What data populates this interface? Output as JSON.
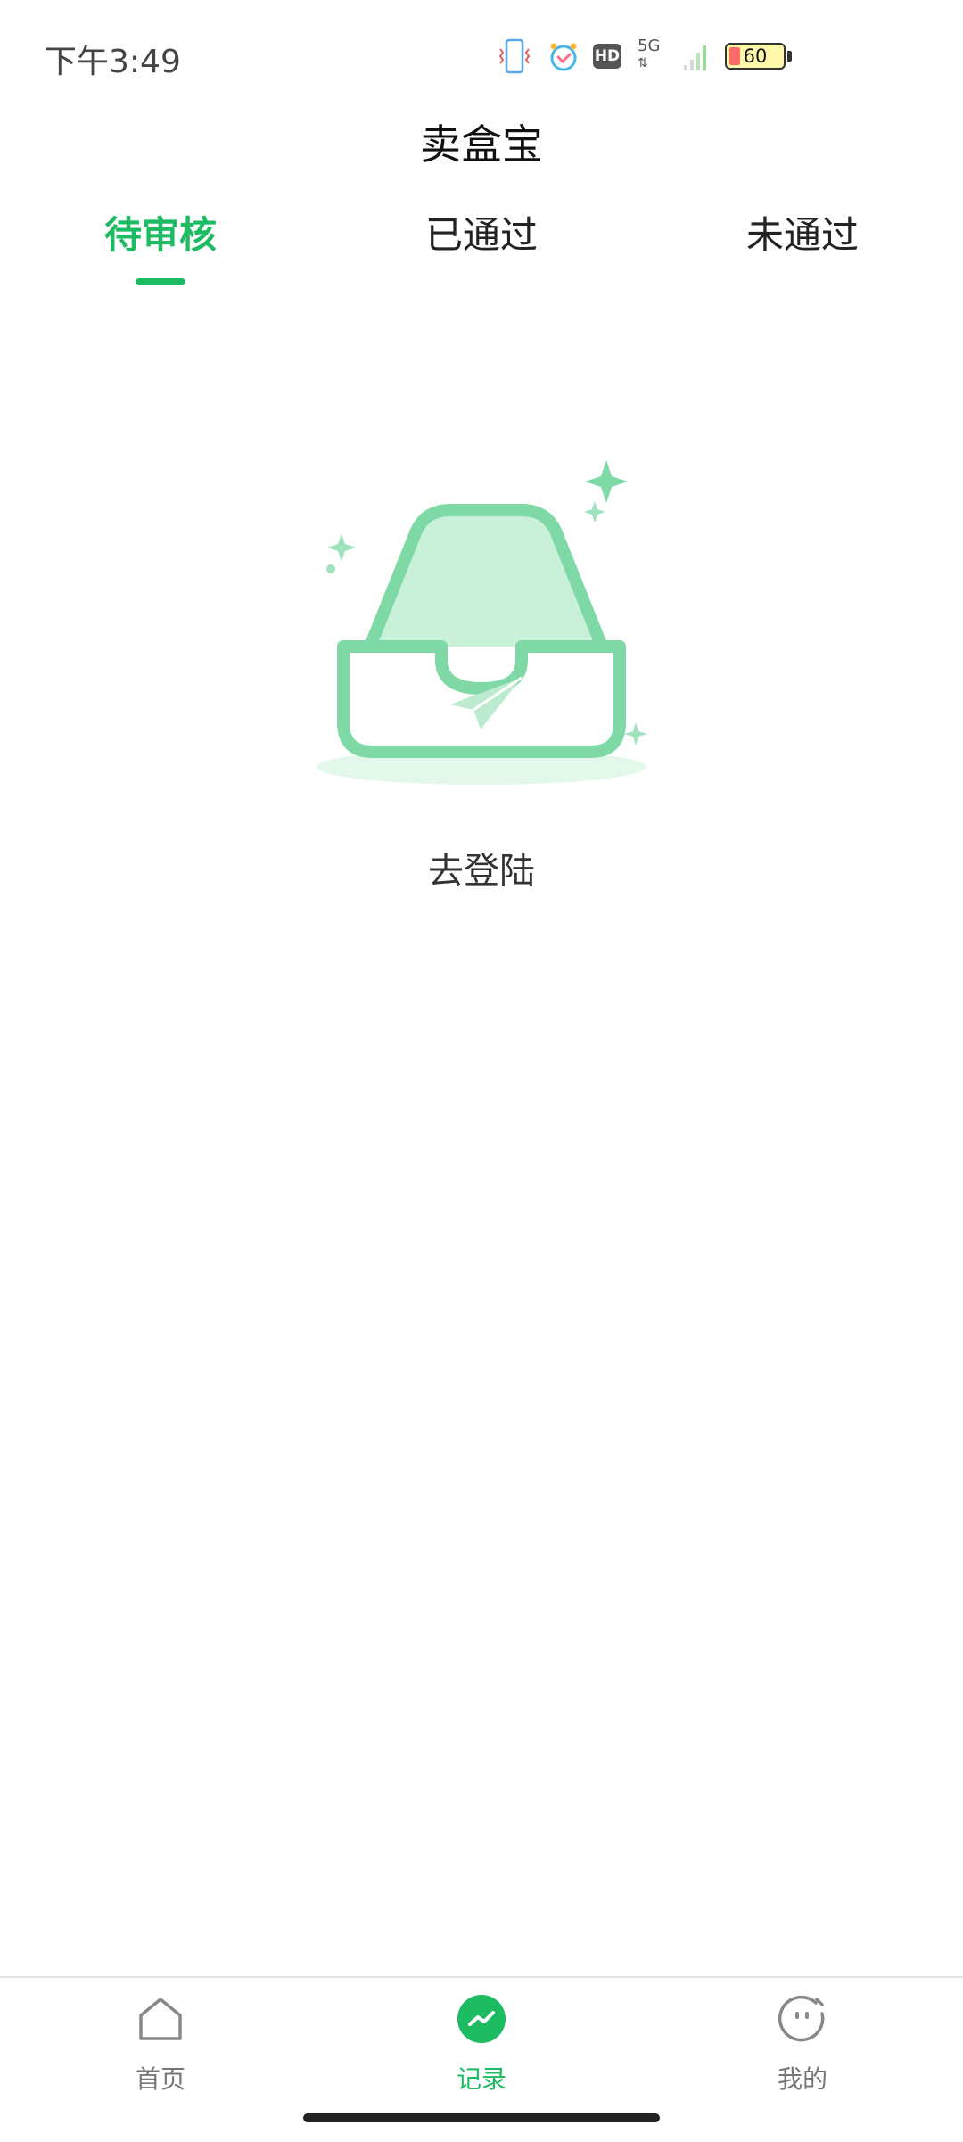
{
  "status_bar": {
    "time": "下午3:49",
    "hd": "HD",
    "network": "5G",
    "battery": "60",
    "icons": [
      "vibrate-icon",
      "alarm-icon",
      "hd-icon",
      "signal-5g-icon",
      "battery-icon"
    ]
  },
  "app": {
    "title": "卖盒宝"
  },
  "tabs": [
    {
      "label": "待审核",
      "active": true
    },
    {
      "label": "已通过",
      "active": false
    },
    {
      "label": "未通过",
      "active": false
    }
  ],
  "empty_state": {
    "illustration": "empty-inbox-illustration",
    "action_text": "去登陆"
  },
  "bottom_nav": [
    {
      "label": "首页",
      "icon": "home-icon",
      "active": false
    },
    {
      "label": "记录",
      "icon": "chart-icon",
      "active": true
    },
    {
      "label": "我的",
      "icon": "profile-face-icon",
      "active": false
    }
  ],
  "colors": {
    "accent": "#1dbc63",
    "illustration_green": "#7ed9a6",
    "inactive": "#777777"
  }
}
